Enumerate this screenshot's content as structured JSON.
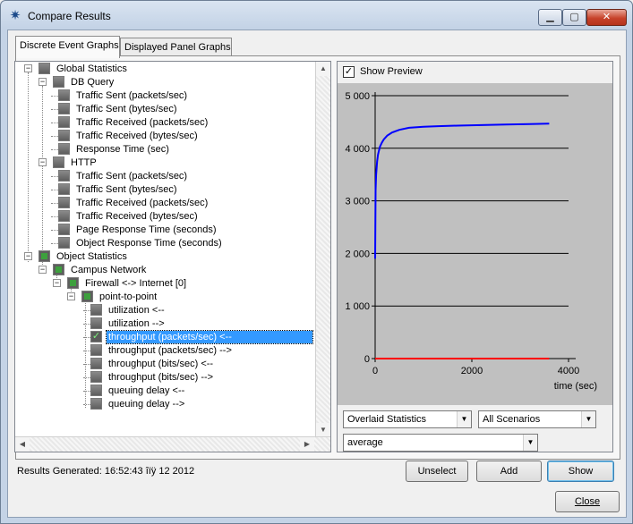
{
  "window": {
    "title": "Compare Results",
    "minimize_label": "▁",
    "maximize_label": "▢",
    "close_label": "✕"
  },
  "tabs": [
    {
      "label": "Discrete Event Graphs",
      "active": true
    },
    {
      "label": "Displayed Panel Graphs",
      "active": false
    }
  ],
  "tree": {
    "global": {
      "label": "Global Statistics",
      "db_query": {
        "label": "DB Query",
        "items": [
          "Traffic Sent (packets/sec)",
          "Traffic Sent (bytes/sec)",
          "Traffic Received (packets/sec)",
          "Traffic Received (bytes/sec)",
          "Response Time (sec)"
        ]
      },
      "http": {
        "label": "HTTP",
        "items": [
          "Traffic Sent (packets/sec)",
          "Traffic Sent (bytes/sec)",
          "Traffic Received (packets/sec)",
          "Traffic Received (bytes/sec)",
          "Page Response Time (seconds)",
          "Object Response Time (seconds)"
        ]
      }
    },
    "object": {
      "label": "Object Statistics",
      "campus": {
        "label": "Campus Network",
        "firewall": {
          "label": "Firewall <-> Internet [0]",
          "p2p": {
            "label": "point-to-point",
            "items": [
              {
                "label": "utilization <--",
                "checked": false
              },
              {
                "label": "utilization -->",
                "checked": false
              },
              {
                "label": "throughput (packets/sec) <--",
                "checked": true,
                "selected": true
              },
              {
                "label": "throughput (packets/sec) -->",
                "checked": false
              },
              {
                "label": "throughput (bits/sec) <--",
                "checked": false
              },
              {
                "label": "throughput (bits/sec) -->",
                "checked": false
              },
              {
                "label": "queuing delay <--",
                "checked": false
              },
              {
                "label": "queuing delay -->",
                "checked": false
              }
            ]
          }
        }
      }
    }
  },
  "preview": {
    "show_preview_label": "Show Preview",
    "show_preview_checked": true
  },
  "chart_data": {
    "type": "line",
    "xlabel": "time (sec)",
    "ylabel": "",
    "title": "",
    "xlim": [
      0,
      4000
    ],
    "ylim": [
      0,
      5000
    ],
    "xticks": [
      0,
      2000,
      4000
    ],
    "xtick_labels": [
      "0",
      "2000",
      "4000"
    ],
    "yticks": [
      0,
      1000,
      2000,
      3000,
      4000,
      5000
    ],
    "ytick_labels": [
      "0",
      "1 000",
      "2 000",
      "3 000",
      "4 000",
      "5 000"
    ],
    "grid": "horizontal",
    "series": [
      {
        "color": "#0000ff",
        "x": [
          0,
          5,
          10,
          20,
          40,
          60,
          80,
          100,
          140,
          180,
          250,
          350,
          500,
          700,
          1000,
          1300,
          1700,
          2200,
          2700,
          3200,
          3600
        ],
        "y": [
          1900,
          2700,
          3200,
          3500,
          3750,
          3880,
          3960,
          4030,
          4110,
          4170,
          4240,
          4300,
          4350,
          4390,
          4410,
          4420,
          4430,
          4440,
          4450,
          4460,
          4470
        ]
      },
      {
        "color": "#ff0000",
        "x": [
          0,
          3600
        ],
        "y": [
          0,
          0
        ]
      }
    ]
  },
  "dropdowns": {
    "stat_mode": "Overlaid Statistics",
    "scenarios": "All Scenarios",
    "filter": "average"
  },
  "footer": {
    "results_generated": "Results Generated: 16:52:43 îïÿ 12 2012"
  },
  "buttons": {
    "unselect": "Unselect",
    "add": "Add",
    "show": "Show",
    "close": "Close"
  }
}
